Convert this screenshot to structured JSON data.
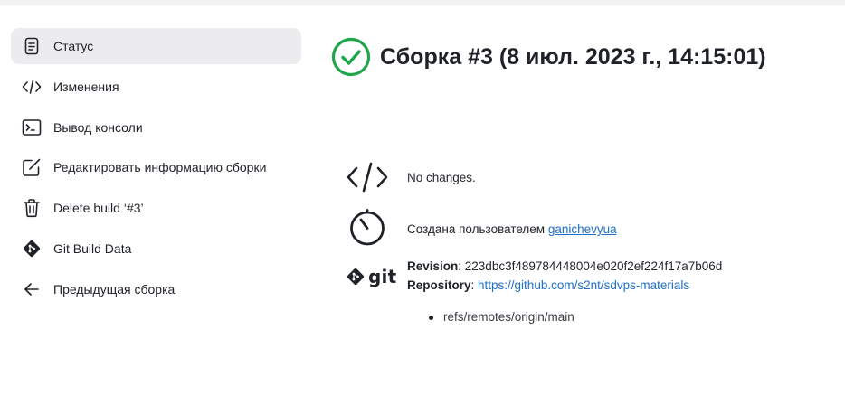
{
  "sidebar": {
    "items": [
      {
        "label": "Статус",
        "icon": "document-icon"
      },
      {
        "label": "Изменения",
        "icon": "code-icon"
      },
      {
        "label": "Вывод консоли",
        "icon": "terminal-icon"
      },
      {
        "label": "Редактировать информацию сборки",
        "icon": "edit-icon"
      },
      {
        "label": "Delete build ‘#3’",
        "icon": "trash-icon"
      },
      {
        "label": "Git Build Data",
        "icon": "git-icon"
      },
      {
        "label": "Предыдущая сборка",
        "icon": "arrow-left-icon"
      }
    ]
  },
  "main": {
    "title": "Сборка #3 (8 июл. 2023 г., 14:15:01)",
    "status_color": "#1ea64b",
    "changes_text": "No changes.",
    "started_by_prefix": "Создана пользователем ",
    "started_by_user": "ganichevyua",
    "git": {
      "logo_text": "git",
      "revision_label": "Revision",
      "revision_value": ": 223dbc3f489784448004e020f2ef224f17a7b06d",
      "repository_label": "Repository",
      "repository_sep": ": ",
      "repository_url": "https://github.com/s2nt/sdvps-materials",
      "branches": [
        "refs/remotes/origin/main"
      ]
    }
  }
}
